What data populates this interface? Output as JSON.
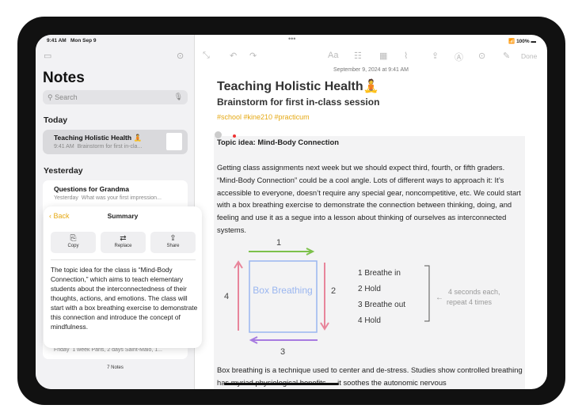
{
  "status": {
    "time": "9:41 AM",
    "date": "Mon Sep 9",
    "battery": "100%"
  },
  "sidebar": {
    "title": "Notes",
    "search_placeholder": "Search",
    "sections": [
      {
        "label": "Today"
      },
      {
        "label": "Yesterday"
      }
    ],
    "notes": [
      {
        "title": "Teaching Holistic Health 🧘",
        "time": "9:41 AM",
        "preview": "Brainstorm for first in-cla..."
      },
      {
        "title": "Questions for Grandma",
        "time": "Yesterday",
        "preview": "What was your first impression..."
      },
      {
        "title": "",
        "time": "Friday",
        "preview": "1 week Paris, 2 days Saint-Malo, 1..."
      }
    ],
    "count": "7 Notes"
  },
  "summary": {
    "back": "Back",
    "title": "Summary",
    "actions": [
      {
        "label": "Copy",
        "icon": "copy-icon"
      },
      {
        "label": "Replace",
        "icon": "replace-icon"
      },
      {
        "label": "Share",
        "icon": "share-icon"
      }
    ],
    "text": "The topic idea for the class is “Mind-Body Connection,” which aims to teach elementary students about the interconnectedness of their thoughts, actions, and emotions. The class will start with a box breathing exercise to demonstrate this connection and introduce the concept of mindfulness."
  },
  "toolbar": {
    "done": "Done",
    "icons": [
      "resize-icon",
      "undo-icon",
      "redo-icon",
      "format-icon",
      "checklist-icon",
      "table-icon",
      "attachment-icon",
      "share-icon",
      "markup-icon",
      "more-icon",
      "compose-icon"
    ]
  },
  "note": {
    "date": "September 9, 2024 at 9:41 AM",
    "title": "Teaching Holistic Health🧘",
    "subtitle": "Brainstorm for first in-class session",
    "tags": "#school #kine210 #practicum",
    "heading": "Topic idea: Mind-Body Connection",
    "para1": "Getting class assignments next week but we should expect third, fourth, or fifth graders. “Mind-Body Connection” could be a cool angle. Lots of different ways to approach it: It’s accessible to everyone, doesn’t require any special gear, noncompetitive, etc. We could start with a box breathing exercise to demonstrate the connection between thinking, doing, and feeling and use it as a segue into a lesson about thinking of ourselves as interconnected systems.",
    "para2": "Box breathing is a technique used to center and de-stress. Studies show controlled breathing has myriad physiological benefits — it soothes the autonomic nervous",
    "sketch": {
      "box": "Box Breathing",
      "n1": "1",
      "n2": "2",
      "n3": "3",
      "n4": "4",
      "steps": [
        "1  Breathe in",
        "2  Hold",
        "3  Breathe out",
        "4  Hold"
      ],
      "note1": "4 seconds each,",
      "note2": "repeat 4 times"
    }
  },
  "colors": {
    "accent": "#e5a812",
    "green": "#7cc14a",
    "pink": "#e8859b",
    "blue": "#9ab6f0",
    "purple": "#a77ae0"
  }
}
